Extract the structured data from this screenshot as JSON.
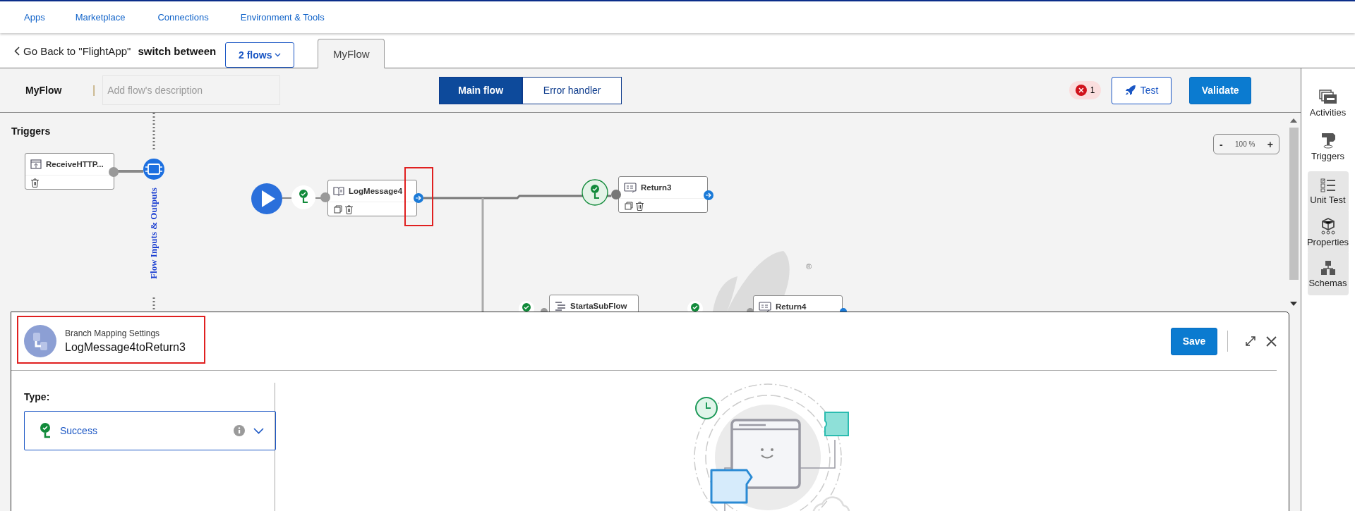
{
  "nav": {
    "links": [
      "Apps",
      "Marketplace",
      "Connections",
      "Environment & Tools"
    ]
  },
  "header": {
    "back_link": "Go Back to \"FlightApp\"",
    "switch_label": "switch between",
    "flows_button": "2 flows",
    "tabs": [
      {
        "label": "MyFlow",
        "selected": true
      }
    ]
  },
  "toolbar": {
    "flow_name": "MyFlow",
    "separator": "|",
    "description": {
      "placeholder": "Add flow's description"
    },
    "views": [
      {
        "label": "Main flow",
        "selected": true
      },
      {
        "label": "Error handler",
        "selected": false
      }
    ],
    "error_count": "1",
    "test_button": "Test",
    "validate_button": "Validate"
  },
  "canvas": {
    "triggers_title": "Triggers",
    "trigger": {
      "label": "ReceiveHTTP..."
    },
    "io_label": "Flow Inputs & Outputs",
    "nodes": [
      {
        "label": "LogMessage4",
        "kind": "log"
      },
      {
        "label": "Return3",
        "kind": "return"
      },
      {
        "label": "StartaSubFlow",
        "kind": "subflow"
      },
      {
        "label": "Return4",
        "kind": "return"
      }
    ],
    "zoom": {
      "minus": "-",
      "value": "100 %",
      "plus": "+"
    },
    "trademark": "®"
  },
  "panel": {
    "subtitle": "Branch Mapping Settings",
    "title": "LogMessage4toReturn3",
    "save_button": "Save",
    "type_label": "Type:",
    "type_value": "Success"
  },
  "sidebar": {
    "items": [
      {
        "label": "Activities",
        "kind": "activities",
        "selected": false
      },
      {
        "label": "Triggers",
        "kind": "triggers",
        "selected": false
      },
      {
        "label": "Unit Test",
        "kind": "unit_test",
        "selected": true
      },
      {
        "label": "Properties",
        "kind": "properties",
        "selected": true
      },
      {
        "label": "Schemas",
        "kind": "schemas",
        "selected": true
      }
    ]
  }
}
